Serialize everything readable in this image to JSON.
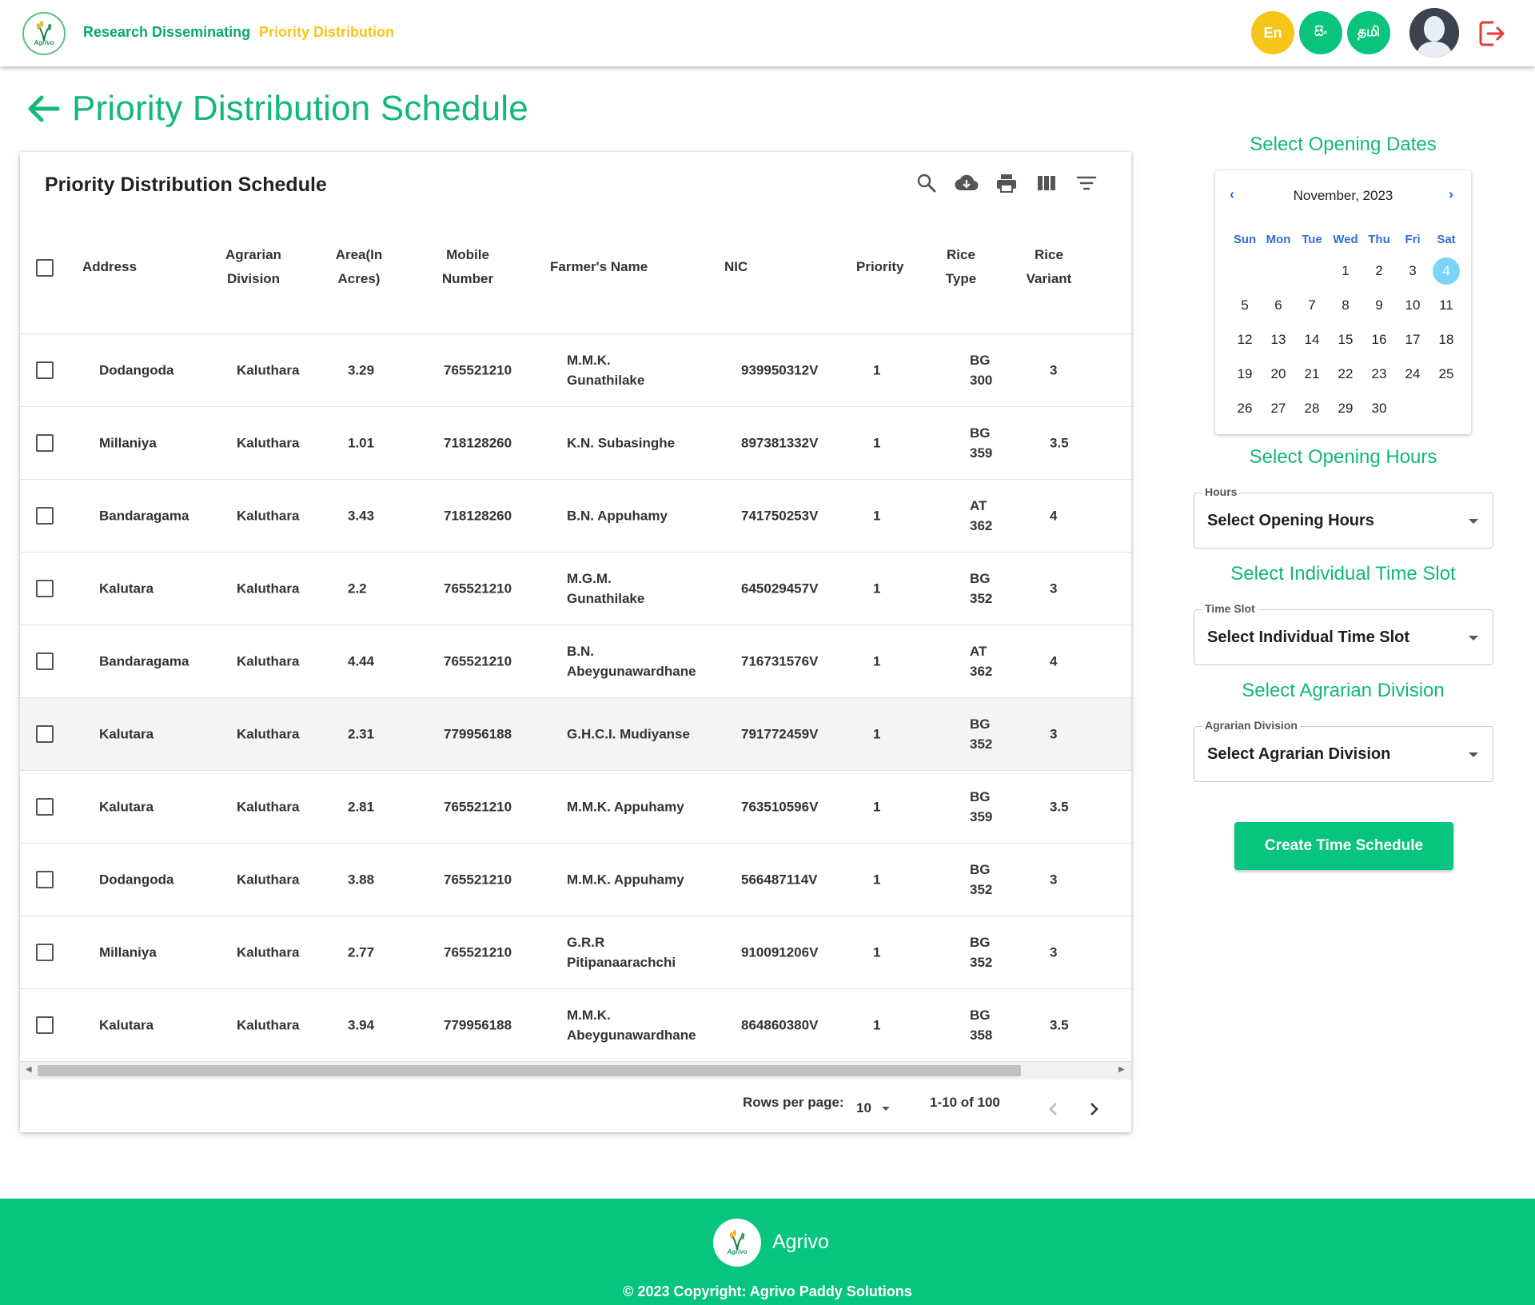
{
  "header": {
    "nav_research": "Research Disseminating",
    "nav_priority": "Priority Distribution",
    "logo_word": "Agrivo",
    "lang_en": "En",
    "lang_si": "සිං",
    "lang_ta": "தமி"
  },
  "page_title": "Priority Distribution Schedule",
  "table": {
    "title": "Priority Distribution Schedule",
    "columns": {
      "address": "Address",
      "agrarian_1": "Agrarian",
      "agrarian_2": "Division",
      "area_1": "Area(In",
      "area_2": "Acres)",
      "mobile_1": "Mobile",
      "mobile_2": "Number",
      "farmer": "Farmer's Name",
      "nic": "NIC",
      "priority": "Priority",
      "rice_type_1": "Rice",
      "rice_type_2": "Type",
      "rice_variant_1": "Rice",
      "rice_variant_2": "Variant"
    },
    "rows": [
      {
        "address": "Dodangoda",
        "division": "Kaluthara",
        "area": "3.29",
        "mobile": "765521210",
        "name_1": "M.M.K.",
        "name_2": "Gunathilake",
        "nic": "939950312V",
        "priority": "1",
        "type_1": "BG",
        "type_2": "300",
        "variant": "3"
      },
      {
        "address": "Millaniya",
        "division": "Kaluthara",
        "area": "1.01",
        "mobile": "718128260",
        "name_1": "K.N. Subasinghe",
        "name_2": "",
        "nic": "897381332V",
        "priority": "1",
        "type_1": "BG",
        "type_2": "359",
        "variant": "3.5"
      },
      {
        "address": "Bandaragama",
        "division": "Kaluthara",
        "area": "3.43",
        "mobile": "718128260",
        "name_1": "B.N. Appuhamy",
        "name_2": "",
        "nic": "741750253V",
        "priority": "1",
        "type_1": "AT",
        "type_2": "362",
        "variant": "4"
      },
      {
        "address": "Kalutara",
        "division": "Kaluthara",
        "area": "2.2",
        "mobile": "765521210",
        "name_1": "M.G.M.",
        "name_2": "Gunathilake",
        "nic": "645029457V",
        "priority": "1",
        "type_1": "BG",
        "type_2": "352",
        "variant": "3"
      },
      {
        "address": "Bandaragama",
        "division": "Kaluthara",
        "area": "4.44",
        "mobile": "765521210",
        "name_1": "B.N.",
        "name_2": "Abeygunawardhane",
        "nic": "716731576V",
        "priority": "1",
        "type_1": "AT",
        "type_2": "362",
        "variant": "4"
      },
      {
        "address": "Kalutara",
        "division": "Kaluthara",
        "area": "2.31",
        "mobile": "779956188",
        "name_1": "G.H.C.I. Mudiyanse",
        "name_2": "",
        "nic": "791772459V",
        "priority": "1",
        "type_1": "BG",
        "type_2": "352",
        "variant": "3"
      },
      {
        "address": "Kalutara",
        "division": "Kaluthara",
        "area": "2.81",
        "mobile": "765521210",
        "name_1": "M.M.K. Appuhamy",
        "name_2": "",
        "nic": "763510596V",
        "priority": "1",
        "type_1": "BG",
        "type_2": "359",
        "variant": "3.5"
      },
      {
        "address": "Dodangoda",
        "division": "Kaluthara",
        "area": "3.88",
        "mobile": "765521210",
        "name_1": "M.M.K. Appuhamy",
        "name_2": "",
        "nic": "566487114V",
        "priority": "1",
        "type_1": "BG",
        "type_2": "352",
        "variant": "3"
      },
      {
        "address": "Millaniya",
        "division": "Kaluthara",
        "area": "2.77",
        "mobile": "765521210",
        "name_1": "G.R.R",
        "name_2": "Pitipanaarachchi",
        "nic": "910091206V",
        "priority": "1",
        "type_1": "BG",
        "type_2": "352",
        "variant": "3"
      },
      {
        "address": "Kalutara",
        "division": "Kaluthara",
        "area": "3.94",
        "mobile": "779956188",
        "name_1": "M.M.K.",
        "name_2": "Abeygunawardhane",
        "nic": "864860380V",
        "priority": "1",
        "type_1": "BG",
        "type_2": "358",
        "variant": "3.5"
      }
    ],
    "pagination": {
      "rows_per_page_label": "Rows per page:",
      "rows_per_page": "10",
      "range": "1-10 of 100"
    }
  },
  "calendar": {
    "section_title": "Select Opening Dates",
    "month": "November, 2023",
    "weekdays": [
      "Sun",
      "Mon",
      "Tue",
      "Wed",
      "Thu",
      "Fri",
      "Sat"
    ],
    "first_weekday_index": 3,
    "days_in_month": 30,
    "selected_day": 4
  },
  "hours": {
    "section_title": "Select Opening Hours",
    "label": "Hours",
    "value": "Select Opening Hours"
  },
  "timeslot": {
    "section_title": "Select Individual Time Slot",
    "label": "Time Slot",
    "value": "Select Individual Time Slot"
  },
  "agrarian": {
    "section_title": "Select Agrarian Division",
    "label": "Agrarian Division",
    "value": "Select Agrarian Division"
  },
  "create_button": "Create Time Schedule",
  "footer": {
    "brand": "Agrivo",
    "logo_word": "Agrivo",
    "copyright": "© 2023 Copyright: Agrivo Paddy Solutions"
  },
  "colors": {
    "brand_green": "#07c47f",
    "accent_yellow": "#f5c518",
    "calendar_blue": "#2f6fd6",
    "selected_day": "#7ed4f5",
    "logout_red": "#e53935"
  }
}
